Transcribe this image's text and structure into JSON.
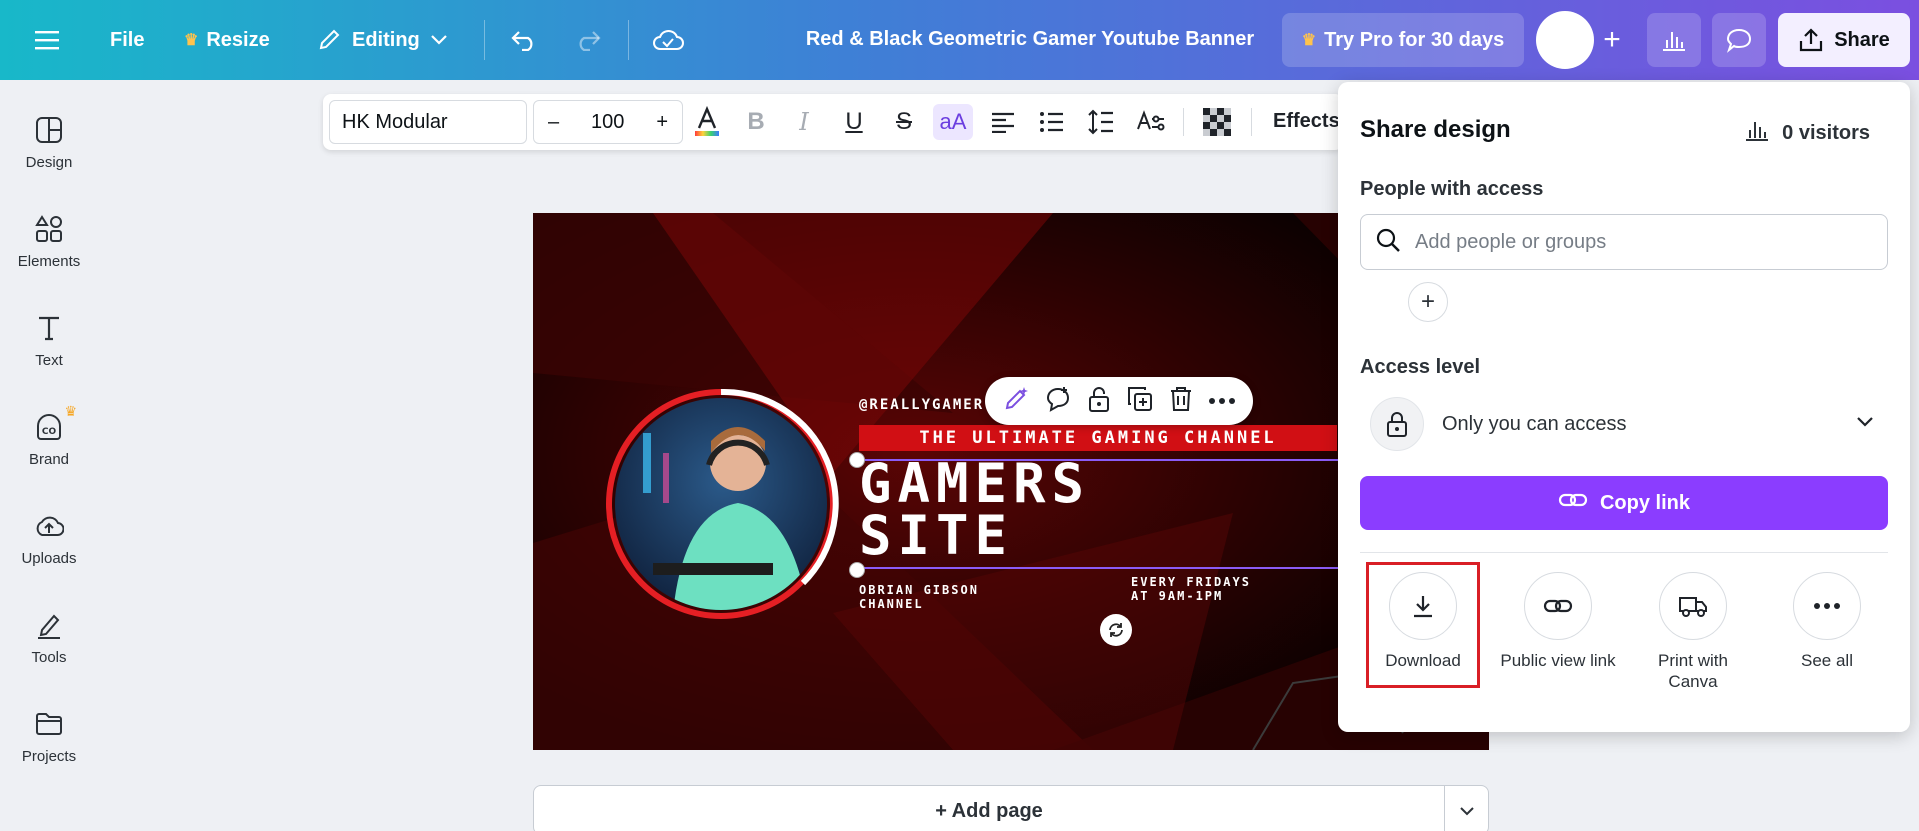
{
  "topbar": {
    "file": "File",
    "resize": "Resize",
    "editing": "Editing",
    "title": "Red & Black Geometric Gamer Youtube Banner",
    "try_pro": "Try Pro for 30 days",
    "share": "Share"
  },
  "sidebar": {
    "items": [
      {
        "label": "Design",
        "icon": "design-icon"
      },
      {
        "label": "Elements",
        "icon": "elements-icon"
      },
      {
        "label": "Text",
        "icon": "text-icon"
      },
      {
        "label": "Brand",
        "icon": "brand-icon"
      },
      {
        "label": "Uploads",
        "icon": "uploads-icon"
      },
      {
        "label": "Tools",
        "icon": "tools-icon"
      },
      {
        "label": "Projects",
        "icon": "projects-icon"
      }
    ]
  },
  "format_toolbar": {
    "font": "HK Modular",
    "minus": "–",
    "size": "100",
    "plus": "+",
    "effects": "Effects"
  },
  "canvas": {
    "handle": "@REALLYGAMER",
    "tagline": "THE ULTIMATE GAMING CHANNEL",
    "title_line1": "GAMERS",
    "title_line2": "SITE",
    "channel_line1": "OBRIAN GIBSON",
    "channel_line2": "CHANNEL",
    "schedule_line1": "EVERY FRIDAYS",
    "schedule_line2": "AT 9AM-1PM"
  },
  "add_page": "+ Add page",
  "share_panel": {
    "title": "Share design",
    "visitors": "0 visitors",
    "people_label": "People with access",
    "search_placeholder": "Add people or groups",
    "access_label": "Access level",
    "access_value": "Only you can access",
    "copy_link": "Copy link",
    "options": [
      {
        "label": "Download",
        "icon": "download-icon"
      },
      {
        "label": "Public view link",
        "icon": "link-icon"
      },
      {
        "label": "Print with Canva",
        "icon": "truck-icon"
      },
      {
        "label": "See all",
        "icon": "more-icon"
      }
    ]
  },
  "colors": {
    "accent_purple": "#8b3dff",
    "highlight_red": "#d91f26",
    "banner_red": "#d10f14"
  }
}
